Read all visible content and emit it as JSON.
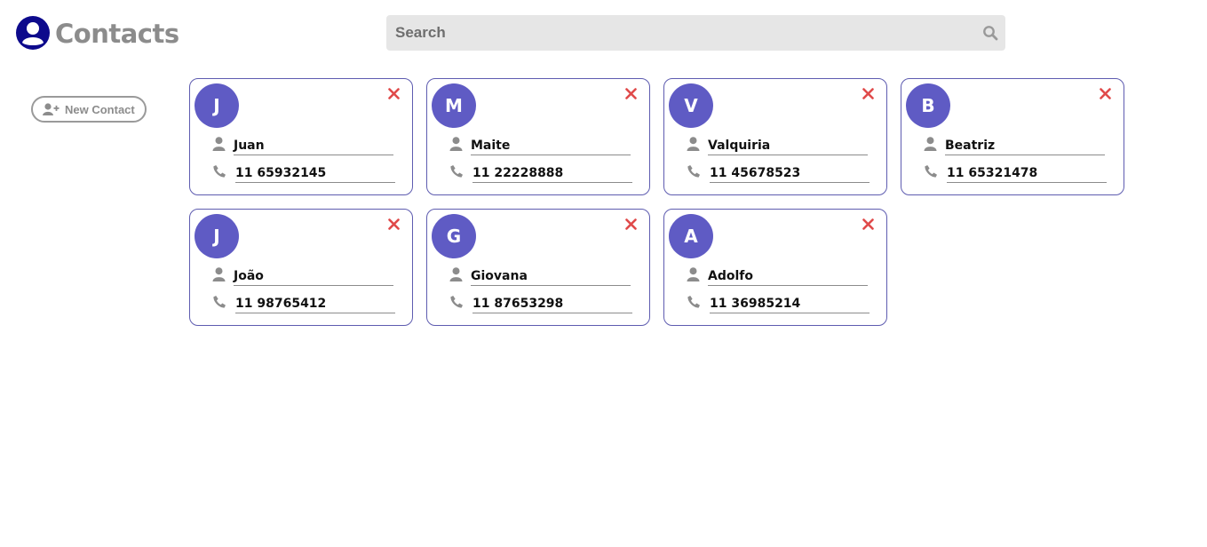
{
  "header": {
    "title": "Contacts",
    "logo_icon": "user-circle-icon"
  },
  "search": {
    "placeholder": "Search",
    "value": "",
    "icon": "search-icon"
  },
  "sidebar": {
    "new_contact_label": "New Contact",
    "new_contact_icon": "user-plus-icon"
  },
  "colors": {
    "avatar": "#5f5bc4",
    "card_border": "#5e5cb0",
    "delete": "#e04a4a",
    "muted_icon": "#8c8c8c"
  },
  "contacts": [
    {
      "initial": "J",
      "name": "Juan",
      "phone": "11 65932145"
    },
    {
      "initial": "M",
      "name": "Maite",
      "phone": "11 22228888"
    },
    {
      "initial": "V",
      "name": "Valquiria",
      "phone": "11 45678523"
    },
    {
      "initial": "B",
      "name": "Beatriz",
      "phone": "11 65321478"
    },
    {
      "initial": "J",
      "name": "João",
      "phone": "11 98765412"
    },
    {
      "initial": "G",
      "name": "Giovana",
      "phone": "11 87653298"
    },
    {
      "initial": "A",
      "name": "Adolfo",
      "phone": "11 36985214"
    }
  ]
}
